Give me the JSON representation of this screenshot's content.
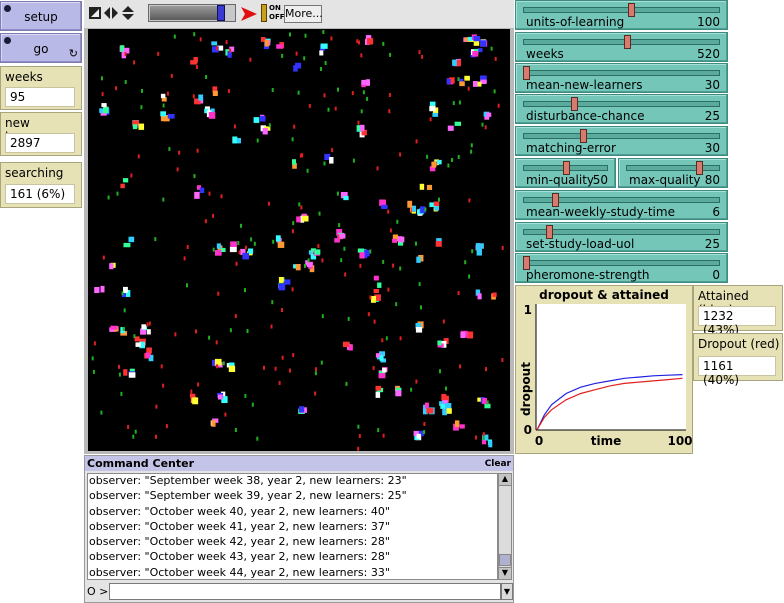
{
  "buttons": {
    "setup_label": "setup",
    "go_label": "go"
  },
  "monitors": {
    "weeks": {
      "label": "weeks",
      "value": "95"
    },
    "new_learners": {
      "label": "new learners",
      "value": "2897"
    },
    "searching": {
      "label": "searching",
      "value": "161 (6%)"
    },
    "attained": {
      "label": "Attained (blue)",
      "value": "1232 (43%)"
    },
    "dropout": {
      "label": "Dropout (red)",
      "value": "1161 (40%)"
    }
  },
  "toolbar": {
    "speed": 0.9,
    "onoff_top": "ON",
    "onoff_bottom": "OFF",
    "more_label": "More..."
  },
  "sliders": [
    {
      "name": "units-of-learning",
      "value": "100",
      "frac": 0.55
    },
    {
      "name": "weeks",
      "value": "520",
      "frac": 0.53
    },
    {
      "name": "mean-new-learners",
      "value": "30",
      "frac": 0.0
    },
    {
      "name": "disturbance-chance",
      "value": "25",
      "frac": 0.25
    },
    {
      "name": "matching-error",
      "value": "30",
      "frac": 0.3
    },
    {
      "name": "min-quality",
      "value": "50",
      "frac": 0.5
    },
    {
      "name": "max-quality",
      "value": "80",
      "frac": 0.8
    },
    {
      "name": "mean-weekly-study-time",
      "value": "6",
      "frac": 0.15
    },
    {
      "name": "set-study-load-uol",
      "value": "25",
      "frac": 0.12
    },
    {
      "name": "pheromone-strength",
      "value": "0",
      "frac": 0.0
    }
  ],
  "chart_data": {
    "type": "line",
    "title": "dropout & attained",
    "xlabel": "time",
    "ylabel": "dropout",
    "xlim": [
      0,
      100
    ],
    "ylim": [
      0,
      1
    ],
    "x_ticks": [
      "0",
      "100"
    ],
    "y_ticks": [
      "0",
      "1"
    ],
    "series": [
      {
        "color": "#2020e0",
        "x": [
          0,
          5,
          10,
          20,
          30,
          40,
          50,
          60,
          70,
          80,
          90,
          100
        ],
        "y": [
          0.0,
          0.12,
          0.2,
          0.29,
          0.34,
          0.37,
          0.39,
          0.41,
          0.42,
          0.43,
          0.435,
          0.44
        ]
      },
      {
        "color": "#e02020",
        "x": [
          0,
          5,
          10,
          20,
          30,
          40,
          50,
          60,
          70,
          80,
          90,
          100
        ],
        "y": [
          0.0,
          0.1,
          0.16,
          0.24,
          0.29,
          0.32,
          0.35,
          0.37,
          0.38,
          0.39,
          0.4,
          0.41
        ]
      }
    ]
  },
  "command_center": {
    "title": "Command Center",
    "clear_label": "Clear",
    "prompt": "O >",
    "lines": [
      "observer: \"September week 38, year 2, new learners: 23\"",
      "observer: \"September week 39, year 2, new learners: 25\"",
      "observer: \"October week 40, year 2, new learners: 40\"",
      "observer: \"October week 41, year 2, new learners: 37\"",
      "observer: \"October week 42, year 2, new learners: 28\"",
      "observer: \"October week 43, year 2, new learners: 28\"",
      "observer: \"October week 44, year 2, new learners: 33\""
    ]
  },
  "colors": {
    "slider": "#74c6b9",
    "button": "#b9b9e8",
    "monitor": "#e6e2b6",
    "world": "#000000"
  }
}
